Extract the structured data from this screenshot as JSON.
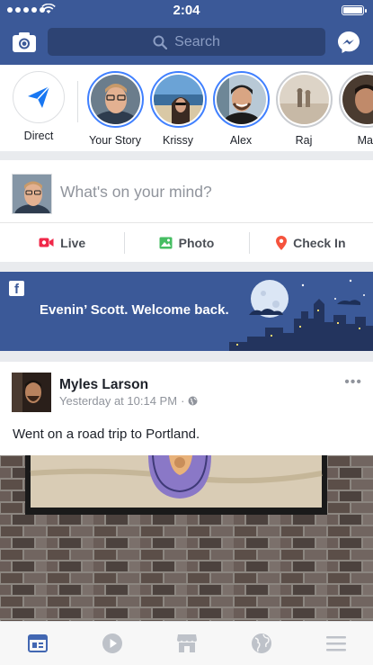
{
  "status_bar": {
    "time": "2:04"
  },
  "header": {
    "search_placeholder": "Search",
    "colors": {
      "brand": "#3b5998",
      "search_bg": "#2d4373"
    }
  },
  "stories": [
    {
      "label": "Direct",
      "kind": "direct"
    },
    {
      "label": "Your Story",
      "kind": "active"
    },
    {
      "label": "Krissy",
      "kind": "active"
    },
    {
      "label": "Alex",
      "kind": "active"
    },
    {
      "label": "Raj",
      "kind": "seen"
    },
    {
      "label": "Mat",
      "kind": "seen"
    }
  ],
  "composer": {
    "prompt": "What's on your mind?",
    "actions": [
      {
        "label": "Live",
        "icon": "live-video-icon",
        "color": "#f02849"
      },
      {
        "label": "Photo",
        "icon": "photo-icon",
        "color": "#45bd62"
      },
      {
        "label": "Check In",
        "icon": "location-pin-icon",
        "color": "#f5533d"
      }
    ]
  },
  "welcome_banner": {
    "message": "Evenin’ Scott. Welcome back."
  },
  "post": {
    "author": "Myles Larson",
    "timestamp": "Yesterday at 10:14 PM",
    "privacy_icon": "globe-icon",
    "text": "Went on a road trip to Portland."
  },
  "tab_bar": [
    {
      "icon": "news-feed-icon",
      "active": true
    },
    {
      "icon": "video-play-icon",
      "active": false
    },
    {
      "icon": "marketplace-icon",
      "active": false
    },
    {
      "icon": "globe-notifications-icon",
      "active": false
    },
    {
      "icon": "menu-icon",
      "active": false
    }
  ]
}
